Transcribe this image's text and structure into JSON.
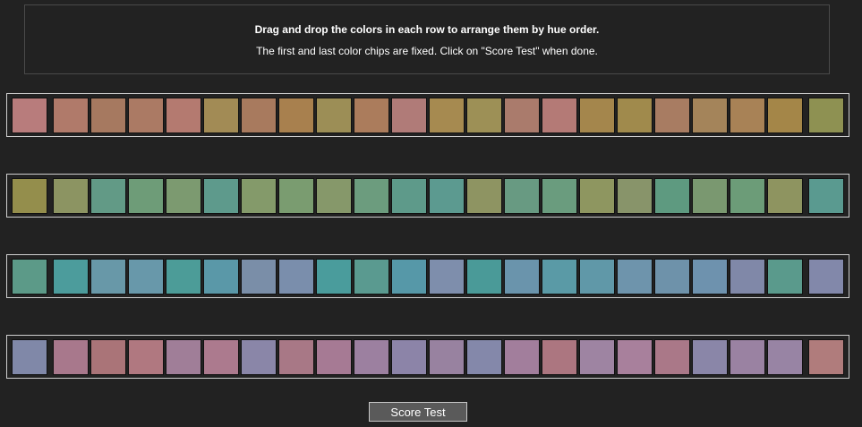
{
  "instructions": {
    "title": "Drag and drop the colors in each row to arrange them by hue order.",
    "subtitle": "The first and last color chips are fixed. Click on \"Score Test\" when done."
  },
  "rows": [
    {
      "chips": [
        "#b87c7c",
        "#b07a6a",
        "#a67960",
        "#ab7a64",
        "#b47a70",
        "#a28b55",
        "#a87a5e",
        "#a8804e",
        "#9c8e56",
        "#ab7c5c",
        "#b07b78",
        "#a68a50",
        "#9d9056",
        "#aa7b6c",
        "#b47a76",
        "#a4864c",
        "#a08a4c",
        "#a87c62",
        "#a4845a",
        "#a88256",
        "#a48648",
        "#8e9152"
      ]
    },
    {
      "chips": [
        "#948e4c",
        "#8c9462",
        "#629a86",
        "#6e9c78",
        "#7c9a70",
        "#5e9a8c",
        "#849a6a",
        "#7a9c70",
        "#86986a",
        "#6c9c7e",
        "#5e9a8a",
        "#5c9a90",
        "#8e9462",
        "#689a82",
        "#6a9c7e",
        "#8e9660",
        "#88946a",
        "#5e9a80",
        "#7a9870",
        "#6c9c78",
        "#8e9460",
        "#5a9a90"
      ]
    },
    {
      "chips": [
        "#5c9a88",
        "#4c9c9c",
        "#6898a8",
        "#6898aa",
        "#4c9c98",
        "#5a98a8",
        "#7a8ea8",
        "#7a8eac",
        "#4a9c9c",
        "#5a9a90",
        "#5698a8",
        "#7e8eac",
        "#4a9a98",
        "#6a94ac",
        "#5a9aa6",
        "#6098a8",
        "#6e94ac",
        "#6e92aa",
        "#6e92ae",
        "#8088a8",
        "#5a9a8c",
        "#8288aa"
      ]
    },
    {
      "chips": [
        "#8088a8",
        "#a8788c",
        "#aa7478",
        "#b07880",
        "#a07e98",
        "#ac7a8e",
        "#8a86a8",
        "#a87886",
        "#a67a94",
        "#9c80a0",
        "#8c84a8",
        "#9882a0",
        "#8488aa",
        "#a27e9c",
        "#ac7680",
        "#9e84a2",
        "#a8809c",
        "#aa7888",
        "#8a86a8",
        "#9a82a2",
        "#9884a4",
        "#b07c7c"
      ]
    }
  ],
  "score_button": {
    "label": "Score Test"
  }
}
